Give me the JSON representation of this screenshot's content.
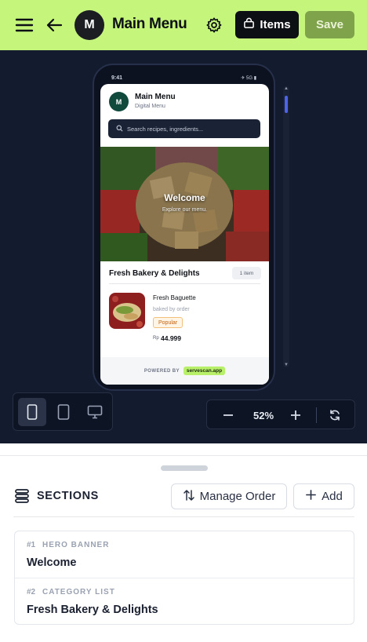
{
  "topbar": {
    "avatar_letter": "M",
    "title": "Main Menu",
    "items_label": "Items",
    "save_label": "Save"
  },
  "phone": {
    "status_time": "9:41",
    "status_network": "5G",
    "avatar_letter": "M",
    "title": "Main Menu",
    "subtitle": "Digital Menu",
    "search_placeholder": "Search recipes, ingredients...",
    "hero": {
      "title": "Welcome",
      "subtitle": "Explore our menu."
    },
    "category": {
      "title": "Fresh Bakery & Delights",
      "count": "1 item"
    },
    "item": {
      "name": "Fresh Baguette",
      "description": "baked by order",
      "badge": "Popular",
      "currency": "Rp",
      "price": "44.999"
    },
    "footer": {
      "powered": "POWERED BY",
      "brand": "servescan.app"
    }
  },
  "zoom": {
    "value": "52%"
  },
  "panel": {
    "title": "SECTIONS",
    "manage_order_label": "Manage Order",
    "add_label": "Add",
    "sections": [
      {
        "num": "#1",
        "type": "HERO BANNER",
        "name": "Welcome"
      },
      {
        "num": "#2",
        "type": "CATEGORY LIST",
        "name": "Fresh Bakery & Delights"
      }
    ]
  },
  "colors": {
    "topbar_bg": "#c5f57a",
    "preview_bg": "#131b2e",
    "save_bg": "#7ea34a",
    "accent_blue": "#4d63e8",
    "brand_green": "#b8f06a"
  }
}
